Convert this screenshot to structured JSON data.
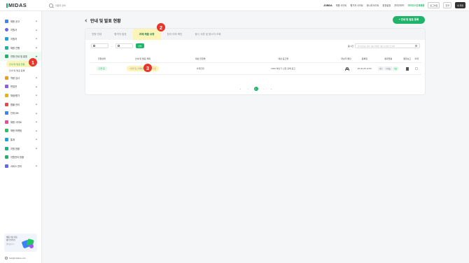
{
  "topbar": {
    "logo": "MIDAS",
    "search_placeholder": "지원자 검색",
    "nav": [
      "JOBDA",
      "채용 사이트",
      "평가자 사이트",
      "응시자사이트",
      "환경설정",
      "관리자모드"
    ],
    "highlight_link": "마이다스인재채용",
    "buttons": [
      "로그아웃",
      "한국",
      "내 계정"
    ]
  },
  "sidebar": {
    "items": [
      {
        "label": "채용 공고",
        "color": "#3b82f6"
      },
      {
        "label": "지원서",
        "color": "#6366f1"
      },
      {
        "label": "지원자",
        "color": "#0ea5e9"
      },
      {
        "label": "채용 진행",
        "color": "#14b8a6"
      },
      {
        "label": "전형 안내 및 발표",
        "color": "#1fb46a"
      },
      {
        "label": "역량 검사",
        "color": "#f59e0b"
      },
      {
        "label": "면접관",
        "color": "#8b5cf6"
      },
      {
        "label": "채점/평가",
        "color": "#eab308"
      },
      {
        "label": "합불 관리",
        "color": "#ef4444"
      },
      {
        "label": "인재 DB",
        "color": "#3b82f6"
      },
      {
        "label": "채용 사이트",
        "color": "#ec4899"
      },
      {
        "label": "채용 마케팅",
        "color": "#22c55e"
      },
      {
        "label": "통계",
        "color": "#0ea5e9"
      },
      {
        "label": "지원 현황",
        "color": "#10b981"
      },
      {
        "label": "자원관리 현황",
        "color": "#1fb46a"
      },
      {
        "label": "서비스 관리",
        "color": "#6366f1"
      }
    ],
    "subitems": [
      "안내 및 발표 현황",
      "안내 및 발표 등록"
    ],
    "banner": {
      "line1": "채용 기술 자동",
      "line2": "평가 솔루션",
      "line3": "알아보기 >"
    },
    "footer": "help@midasin.com"
  },
  "page": {
    "title": "안내 및 발표 현황",
    "primary_button": "+ 안내 및 발표 등록"
  },
  "tabs": [
    "전형 안내",
    "합격자 발표",
    "과제 제출 요청",
    "참석 여부 확인",
    "응시 서류 및 응시자 조회"
  ],
  "filters": {
    "start_date": "",
    "end_date": "",
    "search_button": "검색",
    "total_label": "총 1건",
    "search_placeholder": "안내 및 발표 제목, 대상 전형명, 대상 공고명으로 검색"
  },
  "table": {
    "headers": [
      "전형상태",
      "안내 및 발표 제목",
      "대상 전형명",
      "대상 공고명",
      "대상자 확인",
      "등록일",
      "결과현황",
      "결과보고",
      "이력"
    ],
    "rows": [
      {
        "status": "진행 중",
        "title": "서류전형_과제제출(과제제출) 요청",
        "stage": "서류전형",
        "posting": "2026 하반기 신입 공채 공고",
        "registered": "25.02.28 12:00",
        "results": [
          "대기",
          "미제출",
          "제출"
        ]
      }
    ]
  },
  "pager": {
    "pages": [
      "«",
      "‹",
      "1",
      "›",
      "»"
    ],
    "current": "1"
  },
  "markers": [
    "1",
    "2",
    "3"
  ]
}
